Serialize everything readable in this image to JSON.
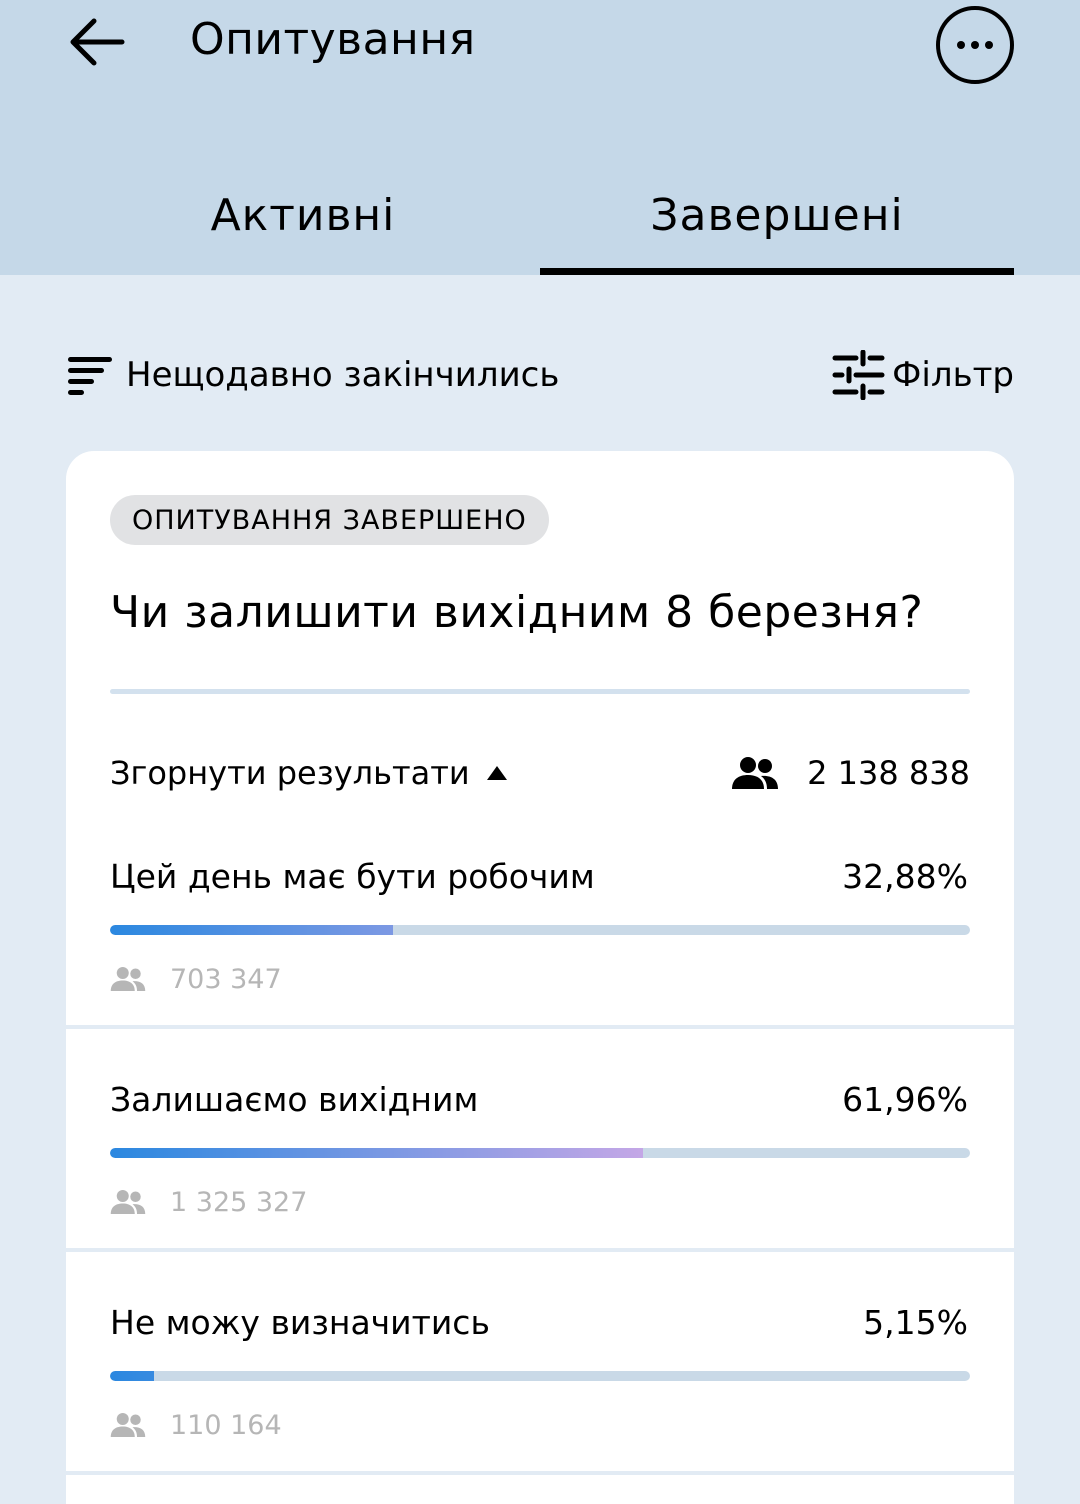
{
  "header": {
    "title": "Опитування",
    "tabs": [
      {
        "label": "Активні",
        "active": false
      },
      {
        "label": "Завершені",
        "active": true
      }
    ]
  },
  "toolbar": {
    "sort_label": "Нещодавно закінчились",
    "filter_label": "Фільтр"
  },
  "poll": {
    "status": "ОПИТУВАННЯ ЗАВЕРШЕНО",
    "question": "Чи залишити вихідним 8 березня?",
    "collapse_label": "Згорнути результати",
    "total_votes": "2 138 838",
    "options": [
      {
        "label": "Цей день має бути робочим",
        "percent": "32,88%",
        "fraction": 0.3288,
        "votes": "703 347"
      },
      {
        "label": "Залишаємо вихідним",
        "percent": "61,96%",
        "fraction": 0.6196,
        "votes": "1 325 327"
      },
      {
        "label": "Не можу визначитись",
        "percent": "5,15%",
        "fraction": 0.0515,
        "votes": "110 164"
      }
    ]
  },
  "colors": {
    "header_bg": "#c5d8e8",
    "page_bg": "#e2ebf4",
    "bar_track": "#c9d9e7",
    "bar_start": "#2b88e0",
    "bar_end": "#c4a7e6",
    "muted_text": "#b6b6b6"
  },
  "icons": {
    "back": "arrow-left-icon",
    "more": "more-dots-icon",
    "sort": "sort-lines-icon",
    "filter": "sliders-icon",
    "collapse": "triangle-up-icon",
    "people": "people-icon"
  }
}
